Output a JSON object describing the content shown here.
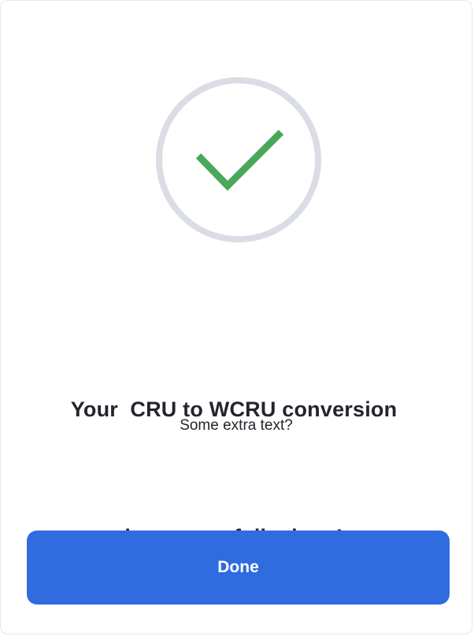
{
  "dialog": {
    "icon": "checkmark-success-icon",
    "title_line_1": "Your  CRU to WCRU conversion",
    "title_line_2": "is successfully done!",
    "subtitle": "Some extra text?",
    "done_label": "Done"
  },
  "colors": {
    "accent": "#316be0",
    "success": "#4aa85a",
    "ring": "#dadee4",
    "text": "#23252e",
    "background": "#ffffff"
  }
}
